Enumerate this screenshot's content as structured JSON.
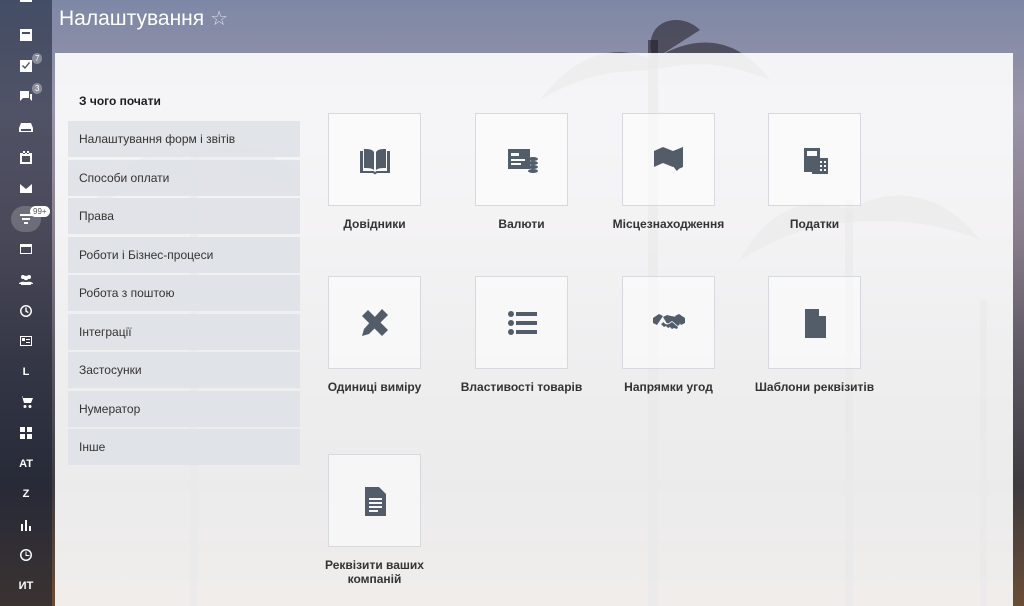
{
  "header": {
    "title": "Налаштування",
    "star_icon": "star-icon"
  },
  "left_bar": {
    "items": [
      {
        "icon": "feed-icon"
      },
      {
        "icon": "tasks-icon",
        "badge": "7"
      },
      {
        "icon": "chat-icon",
        "badge": "3"
      },
      {
        "icon": "drive-icon"
      },
      {
        "icon": "calendar-icon"
      },
      {
        "icon": "mail-icon"
      },
      {
        "icon": "crm-filter-icon",
        "badge": "99+"
      },
      {
        "icon": "sites-icon"
      },
      {
        "icon": "users-icon"
      },
      {
        "icon": "clock-icon"
      },
      {
        "icon": "contact-card-icon"
      },
      {
        "text": "L"
      },
      {
        "icon": "cart-icon"
      },
      {
        "icon": "apps-icon"
      },
      {
        "text": "AT"
      },
      {
        "text": "Z"
      },
      {
        "icon": "bar-chart-icon"
      },
      {
        "icon": "pie-icon"
      },
      {
        "text": "ИТ"
      }
    ]
  },
  "sidebar": {
    "heading": "З чого почати",
    "items": [
      "Налаштування форм і звітів",
      "Способи оплати",
      "Права",
      "Роботи і Бізнес-процеси",
      "Робота з поштою",
      "Інтеграції",
      "Застосунки",
      "Нумератор",
      "Інше"
    ]
  },
  "tiles": [
    {
      "label": "Довідники",
      "icon": "book-icon"
    },
    {
      "label": "Валюти",
      "icon": "currency-icon"
    },
    {
      "label": "Місцезнаходження",
      "icon": "map-icon"
    },
    {
      "label": "Податки",
      "icon": "calculator-icon"
    },
    {
      "label": "Одиниці виміру",
      "icon": "ruler-pencil-icon"
    },
    {
      "label": "Властивості товарів",
      "icon": "list-icon"
    },
    {
      "label": "Напрямки угод",
      "icon": "handshake-icon"
    },
    {
      "label": "Шаблони реквізитів",
      "icon": "document-icon"
    },
    {
      "label": "Реквізити ваших компаній",
      "icon": "text-document-icon"
    }
  ]
}
